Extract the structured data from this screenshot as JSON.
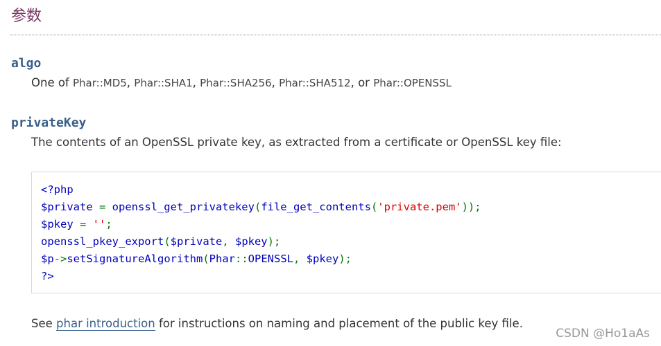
{
  "section": {
    "title": "参数"
  },
  "params": [
    {
      "name": "algo",
      "desc_prefix": "One of ",
      "constants": [
        "Phar::MD5",
        "Phar::SHA1",
        "Phar::SHA256",
        "Phar::SHA512",
        "Phar::OPENSSL"
      ],
      "separators": [
        ", ",
        ", ",
        ", ",
        ", or "
      ]
    },
    {
      "name": "privateKey",
      "desc": "The contents of an OpenSSL private key, as extracted from a certificate or OpenSSL key file:"
    }
  ],
  "code": {
    "line1": "<?php",
    "line2": {
      "var": "$private",
      "eq": " = ",
      "fn1": "openssl_get_privatekey",
      "p1": "(",
      "fn2": "file_get_contents",
      "p2": "(",
      "str": "'private.pem'",
      "p3": "));"
    },
    "line3": {
      "var": "$pkey",
      "eq": " = ",
      "str": "''",
      "semi": ";"
    },
    "line4": {
      "fn": "openssl_pkey_export",
      "p1": "(",
      "arg1": "$private",
      "comma": ", ",
      "arg2": "$pkey",
      "p2": ");"
    },
    "line5": {
      "var": "$p",
      "arrow": "->",
      "fn": "setSignatureAlgorithm",
      "p1": "(",
      "cls": "Phar",
      "dc": "::",
      "const": "OPENSSL",
      "comma": ", ",
      "arg": "$pkey",
      "p2": ");"
    },
    "line6": "?>"
  },
  "footer": {
    "prefix": "See ",
    "link_text": "phar introduction",
    "suffix": " for instructions on naming and placement of the public key file."
  },
  "watermark": "CSDN @Ho1aAs"
}
